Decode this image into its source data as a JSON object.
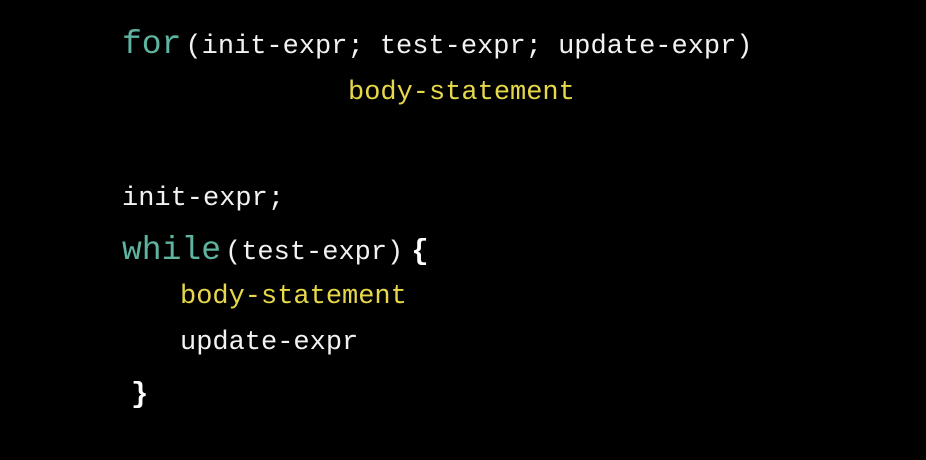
{
  "for_loop": {
    "keyword": "for",
    "header": "(init-expr; test-expr; update-expr)",
    "body": "body-statement"
  },
  "while_loop": {
    "init": "init-expr;",
    "keyword": "while",
    "condition": "(test-expr)",
    "open_brace": "{",
    "body": "body-statement",
    "update": "update-expr",
    "close_brace": "}"
  },
  "colors": {
    "background": "#000000",
    "keyword": "#5fb3a1",
    "text": "#f2f2f2",
    "highlight": "#e6d84a"
  }
}
